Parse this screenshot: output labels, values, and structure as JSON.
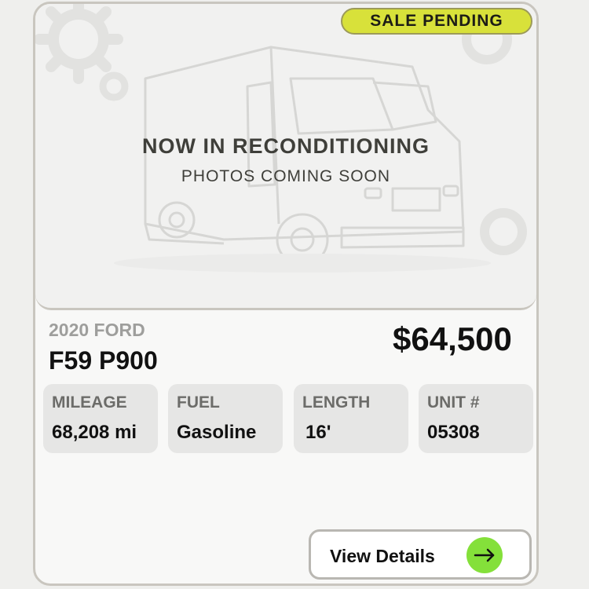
{
  "listing": {
    "badge": "SALE PENDING",
    "photo_title": "NOW IN RECONDITIONING",
    "photo_subtitle": "PHOTOS COMING SOON",
    "year_make": "2020 FORD",
    "model": "F59 P900",
    "price": "$64,500",
    "specs": [
      {
        "label": "MILEAGE",
        "value": "68,208 mi"
      },
      {
        "label": "FUEL",
        "value": "Gasoline"
      },
      {
        "label": "LENGTH",
        "value": "16'"
      },
      {
        "label": "UNIT #",
        "value": "05308"
      }
    ],
    "details_button": "View Details"
  },
  "colors": {
    "badge": "#d8e13a",
    "arrow_button": "#84e03a",
    "card_border": "#c9c6bf"
  },
  "icons": {
    "placeholder_art": "step-van-icon",
    "decoration": "gear-icon",
    "button": "arrow-right-icon"
  }
}
